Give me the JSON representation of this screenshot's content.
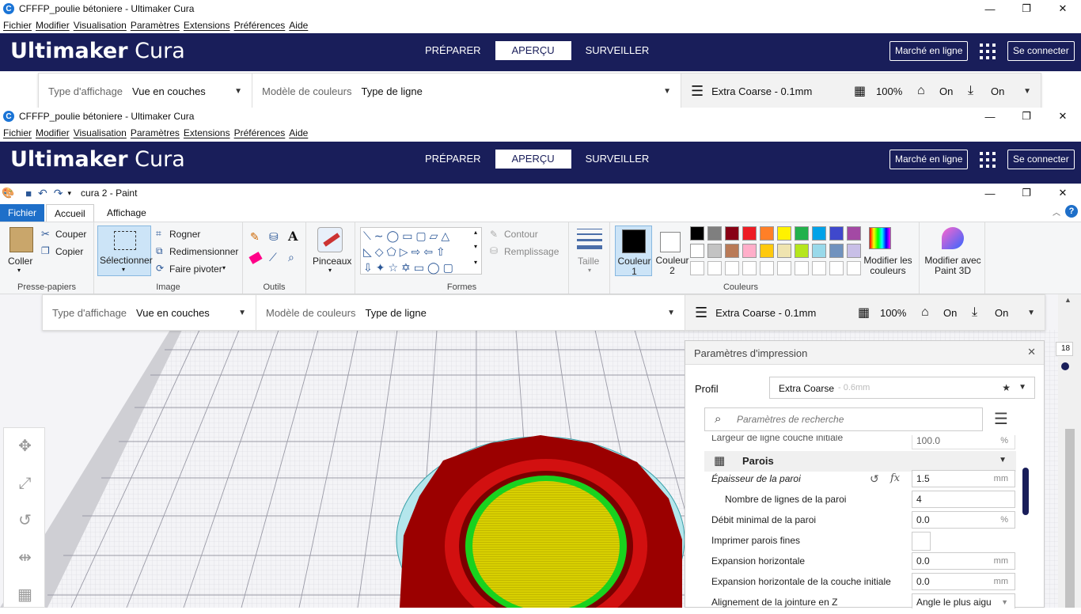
{
  "window1": {
    "title": "CFFFP_poulie bétoniere - Ultimaker Cura",
    "menu": [
      "Fichier",
      "Modifier",
      "Visualisation",
      "Paramètres",
      "Extensions",
      "Préférences",
      "Aide"
    ]
  },
  "window2": {
    "title": "CFFFP_poulie bétoniere - Ultimaker Cura",
    "menu": [
      "Fichier",
      "Modifier",
      "Visualisation",
      "Paramètres",
      "Extensions",
      "Préférences",
      "Aide"
    ]
  },
  "cura": {
    "logo_bold": "Ultimaker",
    "logo_light": "Cura",
    "stages": [
      "PRÉPARER",
      "APERÇU",
      "SURVEILLER"
    ],
    "marketplace": "Marché en ligne",
    "signin": "Se connecter"
  },
  "viewbar": {
    "display_type_label": "Type d'affichage",
    "display_type_value": "Vue en couches",
    "color_scheme_label": "Modèle de couleurs",
    "color_scheme_value": "Type de ligne",
    "profile": "Extra Coarse - 0.1mm",
    "infill": "100%",
    "support": "On",
    "adhesion": "On"
  },
  "paint": {
    "title": "cura 2 - Paint",
    "tabs": [
      "Fichier",
      "Accueil",
      "Affichage"
    ],
    "clipboard": {
      "paste": "Coller",
      "cut": "Couper",
      "copy": "Copier",
      "group": "Presse-papiers"
    },
    "image": {
      "select": "Sélectionner",
      "crop": "Rogner",
      "resize": "Redimensionner",
      "rotate": "Faire pivoter",
      "group": "Image"
    },
    "tools": {
      "group": "Outils"
    },
    "brushes": "Pinceaux",
    "shapes": {
      "outline": "Contour",
      "fill": "Remplissage",
      "group": "Formes"
    },
    "size": "Taille",
    "color1": "Couleur 1",
    "color2": "Couleur 2",
    "colors_group": "Couleurs",
    "edit_colors": "Modifier les couleurs",
    "paint3d": "Modifier avec Paint 3D",
    "palette_row1": [
      "#000000",
      "#7f7f7f",
      "#880015",
      "#ed1c24",
      "#ff7f27",
      "#fff200",
      "#22b14c",
      "#00a2e8",
      "#3f48cc",
      "#a349a4"
    ],
    "palette_row2": [
      "#ffffff",
      "#c3c3c3",
      "#b97a57",
      "#ffaec9",
      "#ffc90e",
      "#efe4b0",
      "#b5e61d",
      "#99d9ea",
      "#7092be",
      "#c8bfe7"
    ]
  },
  "print_settings": {
    "title": "Paramètres d'impression",
    "profile_label": "Profil",
    "profile_value": "Extra Coarse",
    "profile_suffix": "- 0.6mm",
    "search_placeholder": "Paramètres de recherche",
    "cut_row": "Largeur de ligne couche initiale",
    "cut_row_value": "100.0",
    "cut_row_unit": "%",
    "section": "Parois",
    "rows": [
      {
        "label": "Épaisseur de la paroi",
        "value": "1.5",
        "unit": "mm"
      },
      {
        "label": "Nombre de lignes de la paroi",
        "value": "4",
        "unit": ""
      },
      {
        "label": "Débit minimal de la paroi",
        "value": "0.0",
        "unit": "%"
      },
      {
        "label": "Imprimer parois fines",
        "value": "",
        "unit": ""
      },
      {
        "label": "Expansion horizontale",
        "value": "0.0",
        "unit": "mm"
      },
      {
        "label": "Expansion horizontale de la couche initiale",
        "value": "0.0",
        "unit": "mm"
      },
      {
        "label": "Alignement de la jointure en Z",
        "value": "Angle le plus aigu",
        "unit": ""
      }
    ]
  },
  "layer_number": "18"
}
